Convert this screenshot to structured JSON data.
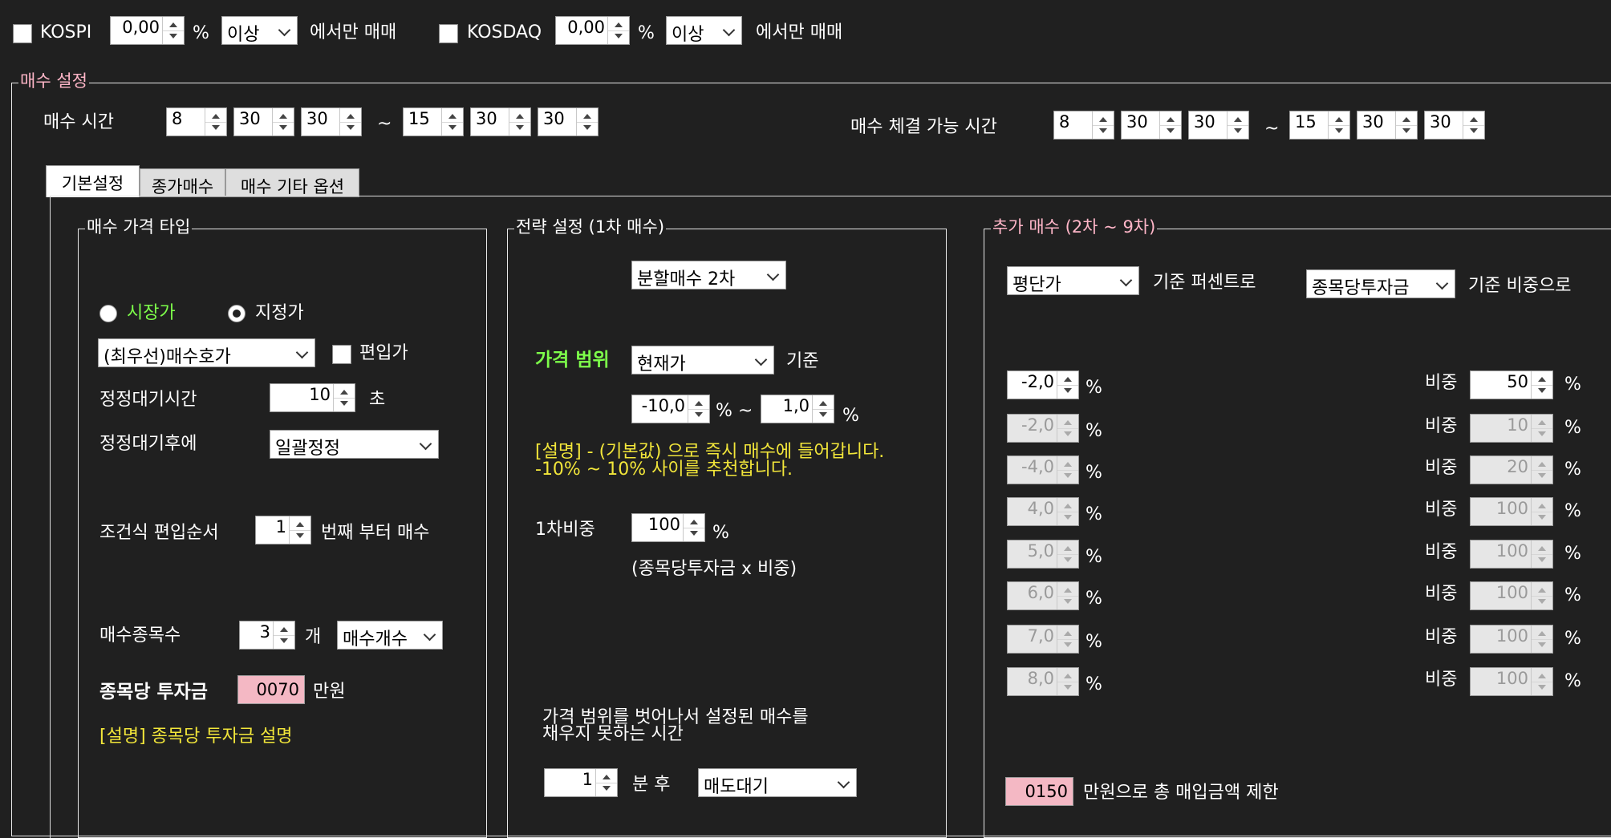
{
  "top": {
    "kospi_label": "KOSPI",
    "kospi_value": "0,00",
    "kospi_pct": "%",
    "kospi_cond": "이상",
    "kospi_tail": "에서만 매매",
    "kosdaq_label": "KOSDAQ",
    "kosdaq_value": "0,00",
    "kosdaq_pct": "%",
    "kosdaq_cond": "이상",
    "kosdaq_tail": "에서만 매매"
  },
  "buy_settings": {
    "title": "매수 설정",
    "buy_time_label": "매수 시간",
    "buy_time_start": [
      "8",
      "30",
      "30"
    ],
    "tilde": "~",
    "buy_time_end": [
      "15",
      "30",
      "30"
    ],
    "exec_time_label": "매수 체결 가능 시간",
    "exec_time_start": [
      "8",
      "30",
      "30"
    ],
    "exec_time_end": [
      "15",
      "30",
      "30"
    ]
  },
  "tabs": [
    "기본설정",
    "종가매수",
    "매수 기타 옵션"
  ],
  "price_type": {
    "title": "매수 가격 타입",
    "market_label": "시장가",
    "limit_label": "지정가",
    "price_combo": "(최우선)매수호가",
    "include_label": "편입가",
    "wait_label": "정정대기시간",
    "wait_value": "10",
    "wait_unit": "초",
    "after_wait_label": "정정대기후에",
    "after_wait_combo": "일괄정정",
    "order_label": "조건식 편입순서",
    "order_value": "1",
    "order_tail": "번째 부터 매수",
    "count_label": "매수종목수",
    "count_value": "3",
    "count_unit": "개",
    "count_combo": "매수개수",
    "invest_label": "종목당 투자금",
    "invest_value": "0070",
    "invest_unit": "만원",
    "invest_desc": "[설명] 종목당 투자금 설명"
  },
  "strategy": {
    "title": "전략 설정 (1차 매수)",
    "split_combo": "분할매수 2차",
    "range_label": "가격 범위",
    "range_combo": "현재가",
    "range_base": "기준",
    "range_low": "-10,0",
    "range_pct1": "% ~",
    "range_high": "1,0",
    "range_pct2": "%",
    "desc_line1": "[설명] - (기본값) 으로 즉시 매수에 들어갑니다.",
    "desc_line2": "-10% ~ 10% 사이를 추천합니다.",
    "first_ratio_label": "1차비중",
    "first_ratio_value": "100",
    "first_ratio_pct": "%",
    "first_ratio_note": "(종목당투자금 x 비중)",
    "timeout_line1": "가격 범위를 벗어나서 설정된 매수를",
    "timeout_line2": "채우지 못하는 시간",
    "timeout_value": "1",
    "timeout_unit": "분 후",
    "timeout_combo": "매도대기"
  },
  "additional": {
    "title": "추가 매수 (2차 ~ 9차)",
    "basis_combo": "평단가",
    "basis_tail": "기준 퍼센트로",
    "weight_combo": "종목당투자금",
    "weight_tail": "기준 비중으로",
    "pct_sign": "%",
    "weight_label": "비중",
    "rows": [
      {
        "pct": "-2,0",
        "weight": "50"
      },
      {
        "pct": "-2,0",
        "weight": "10"
      },
      {
        "pct": "-4,0",
        "weight": "20"
      },
      {
        "pct": "4,0",
        "weight": "100"
      },
      {
        "pct": "5,0",
        "weight": "100"
      },
      {
        "pct": "6,0",
        "weight": "100"
      },
      {
        "pct": "7,0",
        "weight": "100"
      },
      {
        "pct": "8,0",
        "weight": "100"
      }
    ],
    "limit_value": "0150",
    "limit_tail": "만원으로 총 매입금액 제한"
  }
}
